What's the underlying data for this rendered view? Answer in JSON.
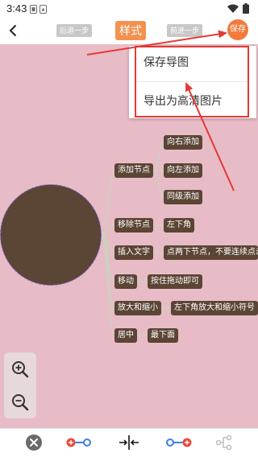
{
  "status_bar": {
    "time": "3:43"
  },
  "toolbar": {
    "undo_label": "后退一步",
    "style_label": "样式",
    "redo_label": "前进一步",
    "save_label": "保存"
  },
  "menu": {
    "items": [
      {
        "label": "保存导图"
      },
      {
        "label": "导出为高清图片"
      }
    ]
  },
  "mindmap": {
    "branches": [
      {
        "label": "添加节点",
        "children": [
          "向右添加",
          "向左添加",
          "同级添加"
        ]
      },
      {
        "label": "移除节点",
        "children": [
          "左下角"
        ]
      },
      {
        "label": "插入文字",
        "children": [
          "点两下节点，不要连续点击"
        ]
      },
      {
        "label": "移动",
        "children": [
          "按住拖动即可"
        ]
      },
      {
        "label": "放大和缩小",
        "children": [
          "左下角放大和缩小符号"
        ]
      },
      {
        "label": "居中",
        "children": [
          "最下面"
        ]
      }
    ]
  },
  "icons": {
    "status_bar": [
      "notification-icon",
      "notification-icon",
      "wifi-icon",
      "battery-icon"
    ],
    "toolbar": [
      "chevron-left-icon"
    ],
    "zoom_panel": [
      "zoom-in-icon",
      "zoom-out-icon"
    ],
    "bottom_bar": [
      "close-icon",
      "insert-node-left-icon",
      "center-icon",
      "insert-node-right-icon",
      "tree-structure-icon"
    ]
  },
  "colors": {
    "accent": "#f3914f",
    "save_button": "#f07b3b",
    "canvas_background": "#e8bcc6",
    "node_background": "#5b4535",
    "node_text": "#ffffff",
    "link": "#c4d6be",
    "selection_outline": "#7e63d8",
    "annotation": "#e53935",
    "icon_blue": "#3f7fe0",
    "icon_red": "#e84c3d"
  }
}
